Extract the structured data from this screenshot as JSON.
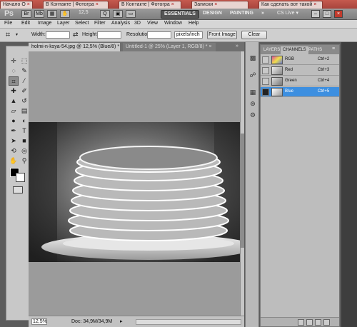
{
  "browser_tabs": [
    {
      "label": "Начало О",
      "close": "×"
    },
    {
      "label": "В Контакте | Фотогра",
      "close": "×"
    },
    {
      "label": "В Контакте | Фотогра",
      "close": "×"
    },
    {
      "label": "Записки",
      "close": "×"
    },
    {
      "label": "Как сделать вот такой",
      "close": "×"
    }
  ],
  "appbar": {
    "logo": "Ps",
    "zoom": "12,5",
    "workspaces": [
      "ESSENTIALS",
      "DESIGN",
      "PAINTING"
    ],
    "more": "»",
    "cs_live": "CS Live"
  },
  "menu": [
    "File",
    "Edit",
    "Image",
    "Layer",
    "Select",
    "Filter",
    "Analysis",
    "3D",
    "View",
    "Window",
    "Help"
  ],
  "options": {
    "width_label": "Width:",
    "height_label": "Height:",
    "resolution_label": "Resolution:",
    "units": "pixels/inch",
    "front_image": "Front Image",
    "clear": "Clear"
  },
  "document": {
    "tabs": [
      {
        "label": "holmi-n-ksya-54.jpg @ 12,5% (Blue/8) *",
        "close": "×"
      },
      {
        "label": "Untitled-1 @ 25% (Layer 1, RGB/8) *",
        "close": "×"
      }
    ],
    "zoom": "12,5%",
    "doc_info": "Doc: 34,9M/34,9M"
  },
  "channels_panel": {
    "tabs": [
      "LAYERS",
      "CHANNELS",
      "PATHS"
    ],
    "rows": [
      {
        "name": "RGB",
        "shortcut": "Ctrl+2"
      },
      {
        "name": "Red",
        "shortcut": "Ctrl+3"
      },
      {
        "name": "Green",
        "shortcut": "Ctrl+4"
      },
      {
        "name": "Blue",
        "shortcut": "Ctrl+5"
      }
    ]
  },
  "colors": {
    "selected_channel": "#3d8fe0",
    "workspace_active": "#555555",
    "close_button": "#c23a2c"
  }
}
